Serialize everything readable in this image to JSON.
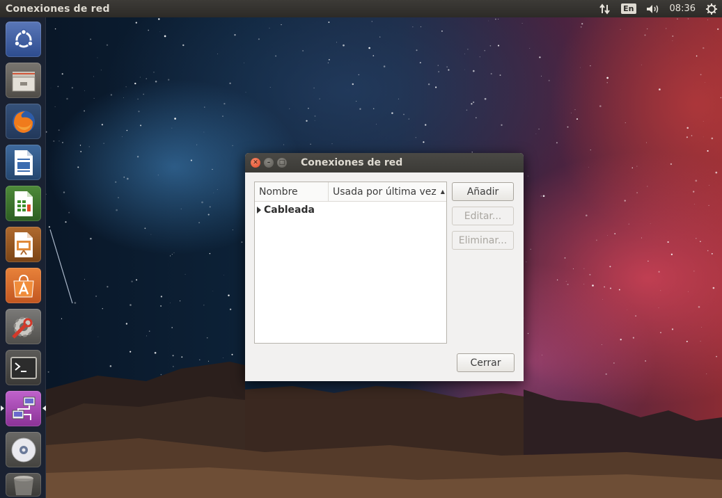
{
  "top_panel": {
    "app_title": "Conexiones de red",
    "keyboard_layout": "En",
    "clock": "08:36"
  },
  "launcher": {
    "items": [
      {
        "icon": "ubuntu-dash-icon"
      },
      {
        "icon": "files-icon"
      },
      {
        "icon": "firefox-icon"
      },
      {
        "icon": "writer-icon"
      },
      {
        "icon": "calc-icon"
      },
      {
        "icon": "impress-icon"
      },
      {
        "icon": "software-center-icon"
      },
      {
        "icon": "system-settings-icon"
      },
      {
        "icon": "terminal-icon"
      },
      {
        "icon": "network-connections-icon",
        "active": true
      },
      {
        "icon": "dvd-icon"
      },
      {
        "icon": "trash-icon"
      }
    ]
  },
  "dialog": {
    "title": "Conexiones de red",
    "columns": {
      "name": "Nombre",
      "last_used": "Usada por última vez"
    },
    "rows": [
      {
        "label": "Cableada"
      }
    ],
    "buttons": {
      "add": "Añadir",
      "edit": "Editar...",
      "delete": "Eliminar...",
      "close": "Cerrar"
    }
  },
  "colors": {
    "panel": "#2c2a27",
    "dialog_bg": "#f2f1f0",
    "close_button": "#df4a2a",
    "launcher_active": "#b24bbd"
  }
}
